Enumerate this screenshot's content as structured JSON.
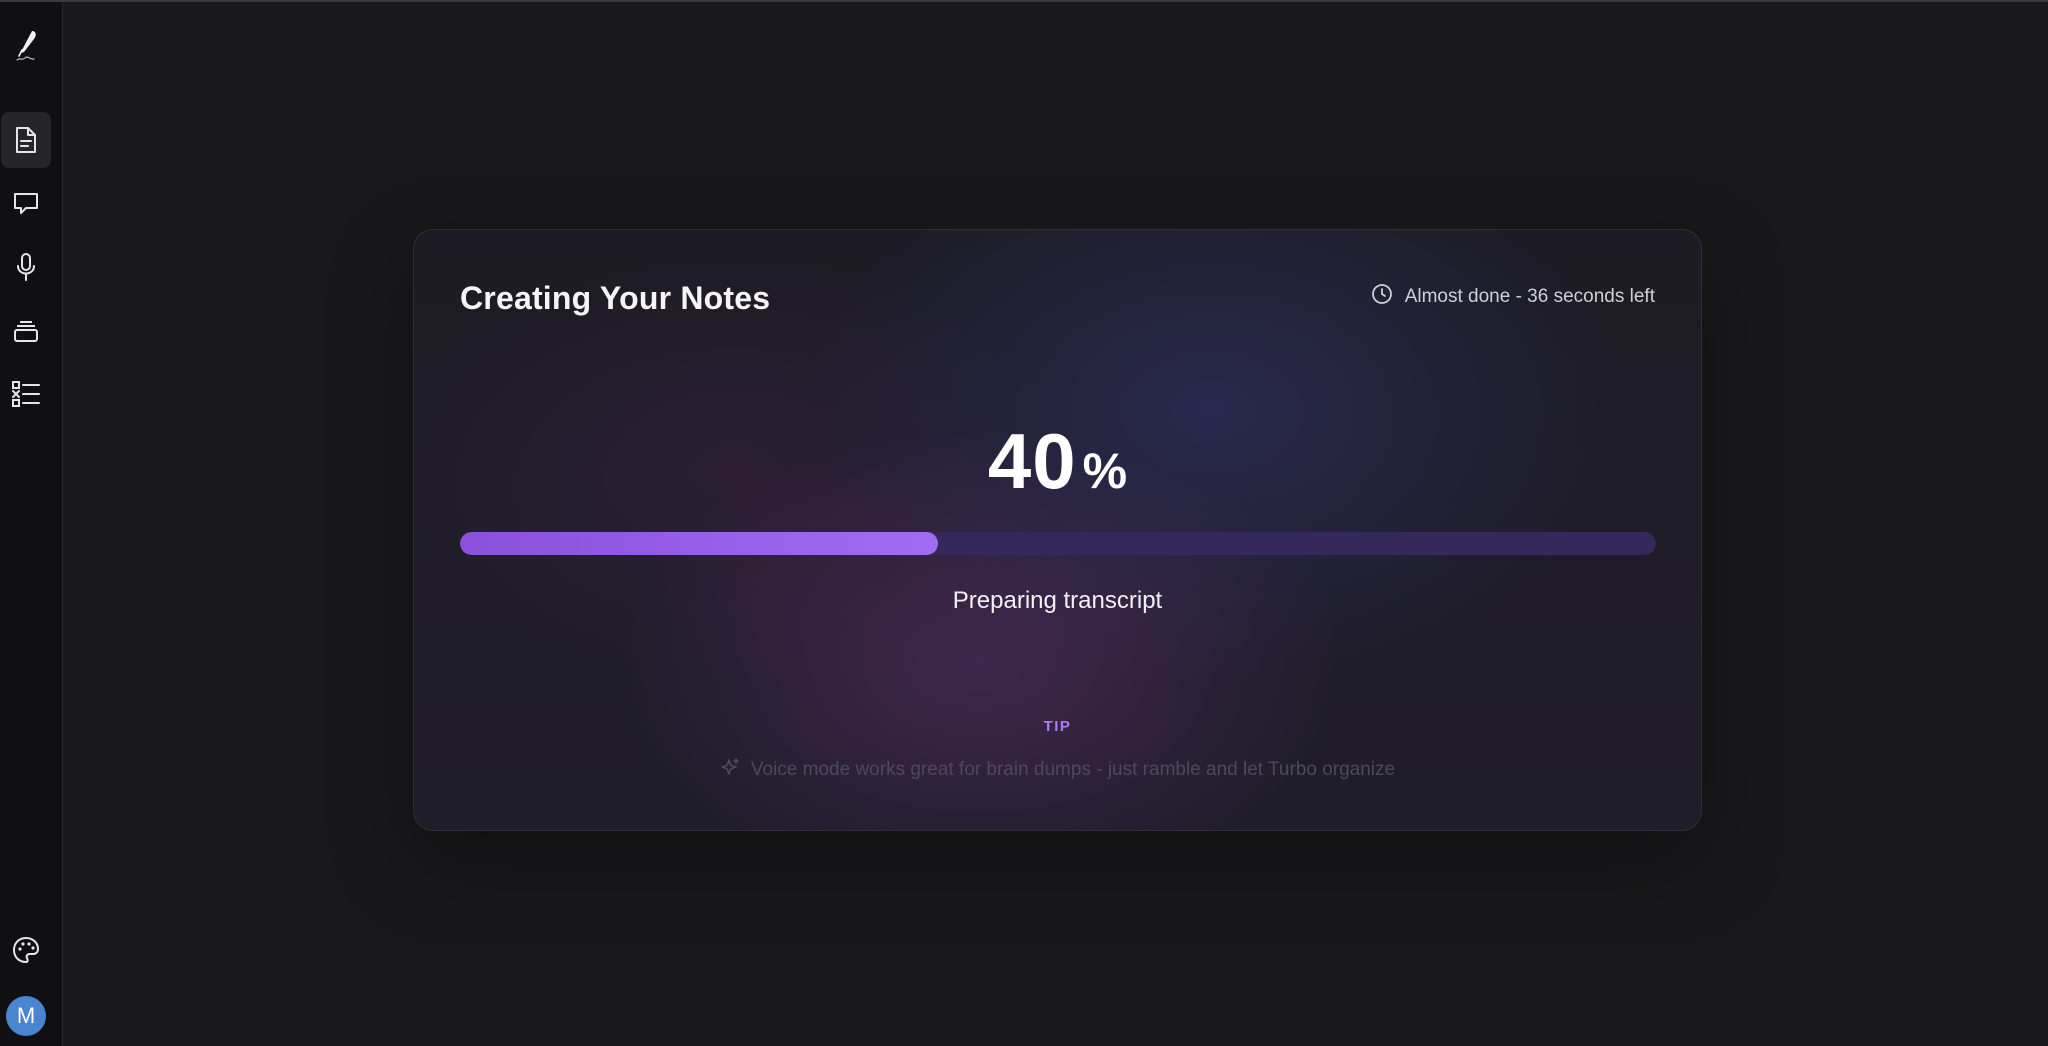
{
  "sidebar": {
    "logo": "quill-pen-icon",
    "items": [
      {
        "icon": "document-icon",
        "active": true
      },
      {
        "icon": "chat-bubble-icon",
        "active": false
      },
      {
        "icon": "microphone-icon",
        "active": false
      },
      {
        "icon": "stacked-folders-icon",
        "active": false
      },
      {
        "icon": "checklist-icon",
        "active": false
      }
    ],
    "bottom": [
      {
        "icon": "palette-icon"
      }
    ],
    "avatar_initial": "M"
  },
  "card": {
    "title": "Creating Your Notes",
    "eta": "Almost done - 36 seconds left",
    "progress_value": "40",
    "progress_symbol": "%",
    "progress_fraction": 0.4,
    "stage": "Preparing transcript",
    "tip_label": "TIP",
    "tip_text": "Voice mode works great for brain dumps - just ramble and let Turbo organize"
  },
  "colors": {
    "background": "#19191b",
    "sidebar": "#101012",
    "accent": "#9b63ee",
    "track": "#34295a",
    "tip_label": "#a97ff0",
    "avatar": "#4a85d0"
  }
}
